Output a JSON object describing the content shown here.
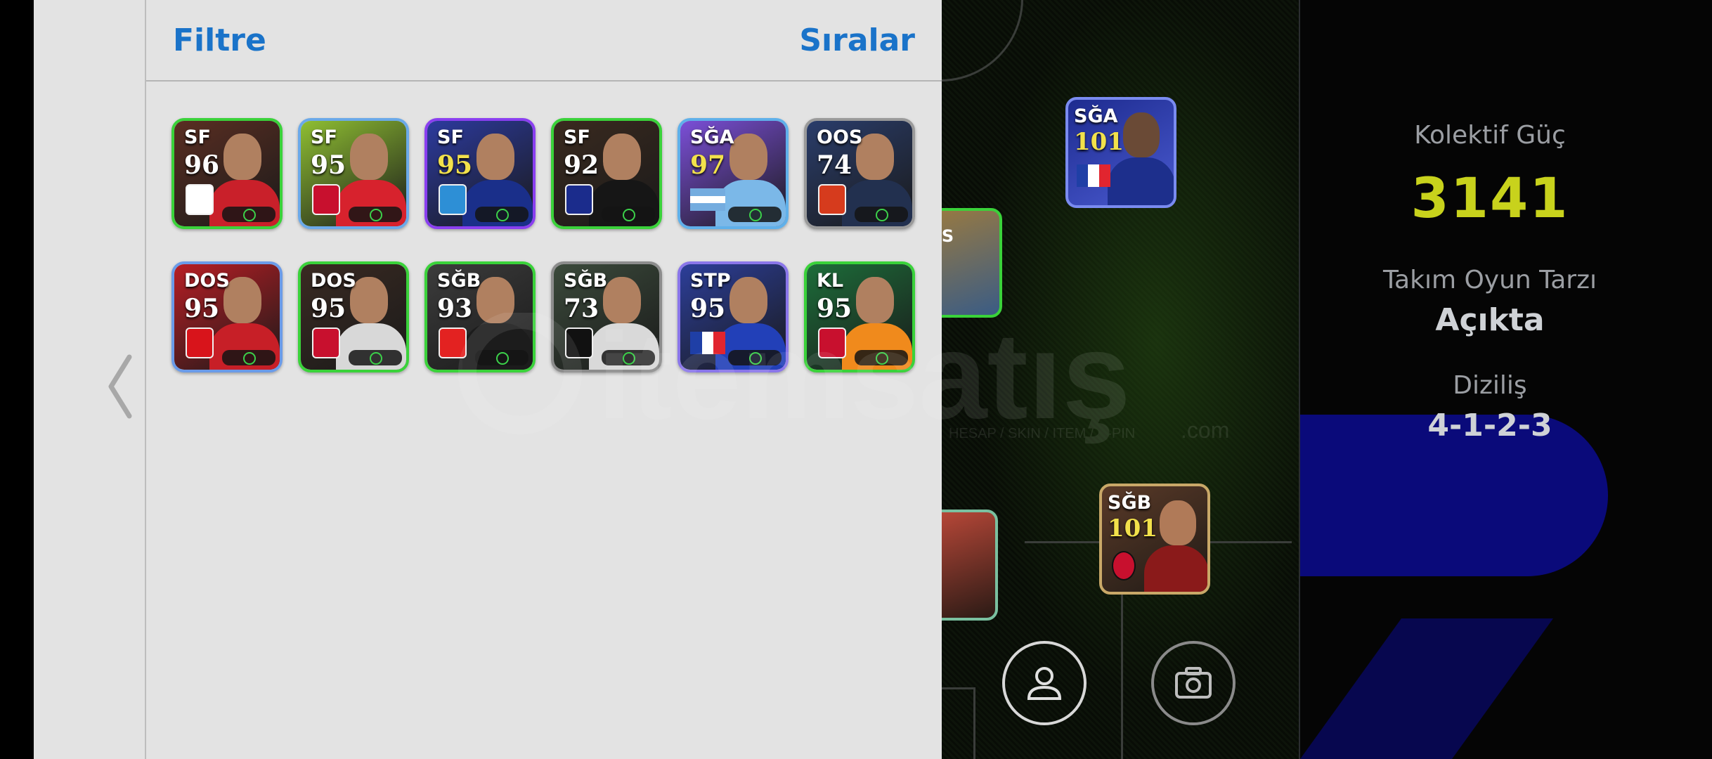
{
  "panel": {
    "filter_label": "Filtre",
    "sort_label": "Sıralar"
  },
  "players": [
    {
      "position": "SF",
      "rating": "96",
      "rating_color": "#ffffff",
      "frame": "#3ad23a",
      "bg": "#5a2e22",
      "shirt": "#c9202a",
      "badge": "#ffffff"
    },
    {
      "position": "SF",
      "rating": "95",
      "rating_color": "#ffffff",
      "frame": "#6ba9e8",
      "bg": "#8fbf32",
      "shirt": "#d7222d",
      "badge": "#c8102e"
    },
    {
      "position": "SF",
      "rating": "95",
      "rating_color": "#f2e14b",
      "frame": "#8a3ff0",
      "bg": "#2c3a9e",
      "shirt": "#1a2f8a",
      "badge": "#2d8fd6"
    },
    {
      "position": "SF",
      "rating": "92",
      "rating_color": "#ffffff",
      "frame": "#3ad23a",
      "bg": "#3a2a1f",
      "shirt": "#161616",
      "badge": "#1b2c8c"
    },
    {
      "position": "SĞA",
      "rating": "97",
      "rating_color": "#f2e14b",
      "frame": "#5fb0ea",
      "bg": "#7b4fd8",
      "shirt": "#7bb8e8",
      "badge": "flag-ar"
    },
    {
      "position": "OOS",
      "rating": "74",
      "rating_color": "#ffffff",
      "frame": "#9a9a9a",
      "bg": "#2a3d6b",
      "shirt": "#22304f",
      "badge": "#d63b1d"
    },
    {
      "position": "DOS",
      "rating": "95",
      "rating_color": "#ffffff",
      "frame": "#6b9be8",
      "bg": "#b81e24",
      "shirt": "#c71f27",
      "badge": "#d8141b"
    },
    {
      "position": "DOS",
      "rating": "95",
      "rating_color": "#ffffff",
      "frame": "#3ad23a",
      "bg": "#3a2a22",
      "shirt": "#d8d8d8",
      "badge": "#c8102e"
    },
    {
      "position": "SĞB",
      "rating": "93",
      "rating_color": "#ffffff",
      "frame": "#3ad23a",
      "bg": "#3c3c3c",
      "shirt": "#1c1c1c",
      "badge": "#e32221"
    },
    {
      "position": "SĞB",
      "rating": "73",
      "rating_color": "#ffffff",
      "frame": "#8c8c8c",
      "bg": "#3b4a3b",
      "shirt": "#d9d9d9",
      "badge": "#111111"
    },
    {
      "position": "STP",
      "rating": "95",
      "rating_color": "#ffffff",
      "frame": "#8a76ea",
      "bg": "#2c3e9a",
      "shirt": "#2240b8",
      "badge": "flag-fr"
    },
    {
      "position": "KL",
      "rating": "95",
      "rating_color": "#ffffff",
      "frame": "#3ad23a",
      "bg": "#1d6d3a",
      "shirt": "#f08a1c",
      "badge": "#c8102e"
    }
  ],
  "pitch_cards": [
    {
      "position": "SĞA",
      "rating": "101",
      "rating_color": "#f2e14b"
    },
    {
      "position": "SĞB",
      "rating": "101",
      "rating_color": "#f2e14b"
    }
  ],
  "stats": {
    "power_label": "Kolektif Güç",
    "power_value": "3141",
    "style_label": "Takım Oyun Tarzı",
    "style_value": "Açıkta",
    "formation_label": "Diziliş",
    "formation_value": "4-1-2-3"
  },
  "watermark": {
    "brand": "itemsatış",
    "tagline": "HESAP / SKIN / ITEM / E-PIN",
    "suffix": ".com"
  },
  "icons": {
    "back": "chevron-left-icon",
    "profile": "person-icon",
    "camera": "camera-icon"
  }
}
